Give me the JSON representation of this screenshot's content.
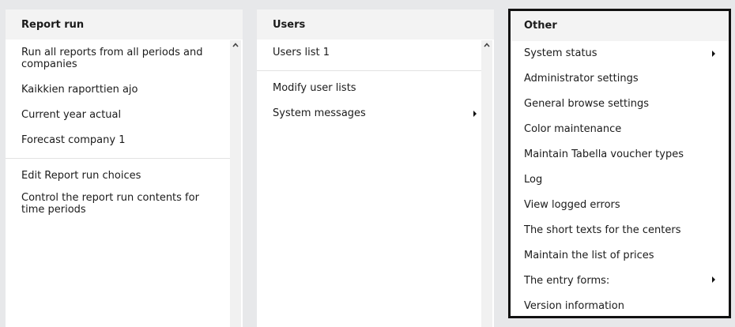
{
  "panels": {
    "report_run": {
      "title": "Report run",
      "items_top": [
        "Run all reports from all periods and companies",
        "Kaikkien raporttien ajo",
        "Current year actual",
        "Forecast company 1"
      ],
      "items_bottom": [
        "Edit Report run choices",
        "Control the report run contents for time periods"
      ]
    },
    "users": {
      "title": "Users",
      "items_top": [
        "Users list 1"
      ],
      "items_bottom": [
        "Modify user lists",
        "System messages"
      ]
    },
    "other": {
      "title": "Other",
      "items": [
        "System status",
        "Administrator settings",
        "General browse settings",
        "Color maintenance",
        "Maintain Tabella voucher types",
        "Log",
        "View logged errors",
        "The short texts for the centers",
        "Maintain the list of prices",
        "The entry forms:",
        "Version information"
      ]
    }
  },
  "icons": {
    "submenu": "chevron-right-icon",
    "scroll_up": "chevron-up-icon"
  }
}
